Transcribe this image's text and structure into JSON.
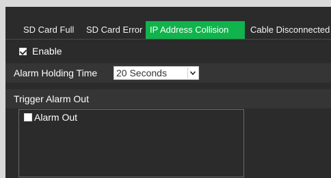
{
  "tabs": [
    {
      "label": "SD Card Full",
      "active": false
    },
    {
      "label": "SD Card Error",
      "active": false
    },
    {
      "label": "IP Address Collision",
      "active": true
    },
    {
      "label": "Cable Disconnected",
      "active": false
    }
  ],
  "enable": {
    "label": "Enable",
    "checked": true
  },
  "alarm_holding_time": {
    "label": "Alarm Holding Time",
    "value": "20 Seconds"
  },
  "trigger": {
    "label": "Trigger Alarm Out"
  },
  "alarm_out": {
    "label": "Alarm Out",
    "checked": false
  },
  "colors": {
    "accent": "#10b34c",
    "background": "#2b2b2b",
    "row": "#353535"
  }
}
